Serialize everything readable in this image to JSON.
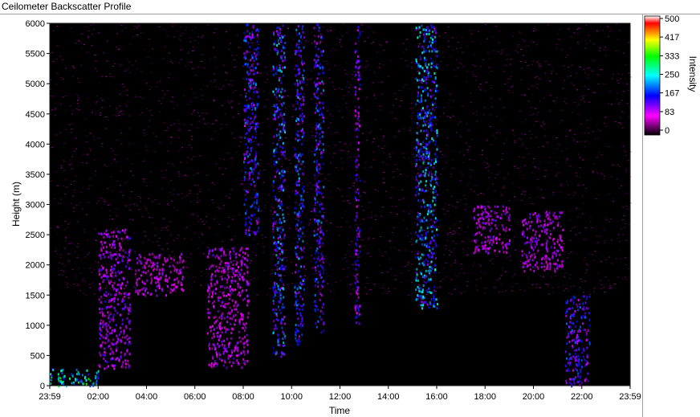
{
  "window": {
    "title": "Ceilometer Backscatter Profile"
  },
  "chart_data": {
    "type": "heatmap",
    "title": "Ceilometer Backscatter Profile",
    "xlabel": "Time",
    "ylabel": "Height (m)",
    "x_tick_labels": [
      "23:59",
      "02:00",
      "04:00",
      "06:00",
      "08:00",
      "10:00",
      "12:00",
      "14:00",
      "16:00",
      "18:00",
      "20:00",
      "22:00",
      "23:59"
    ],
    "xlim_hours": [
      0,
      24
    ],
    "y_ticks": [
      0,
      500,
      1000,
      1500,
      2000,
      2500,
      3000,
      3500,
      4000,
      4500,
      5000,
      5500,
      6000
    ],
    "ylim": [
      0,
      6000
    ],
    "grid": false,
    "colorbar": {
      "label": "Intensity",
      "ticks": [
        500,
        417,
        333,
        250,
        167,
        83,
        0
      ],
      "range": [
        0,
        500
      ],
      "colors": [
        "#000000",
        "#ff00ff",
        "#0000ff",
        "#00ffff",
        "#00ff00",
        "#ffff00",
        "#ff0000",
        "#ffffff"
      ]
    },
    "background_color": "#000000",
    "features": [
      {
        "name": "surface layer",
        "hours": [
          0.0,
          2.0
        ],
        "height": [
          0,
          300
        ],
        "intensity": 250
      },
      {
        "name": "rising layer",
        "hours": [
          2.0,
          3.3
        ],
        "height": [
          300,
          2600
        ],
        "intensity": 110
      },
      {
        "name": "residual layer",
        "hours": [
          3.5,
          5.5
        ],
        "height": [
          1500,
          2200
        ],
        "intensity": 90
      },
      {
        "name": "afternoon layer",
        "hours": [
          6.5,
          8.2
        ],
        "height": [
          300,
          2300
        ],
        "intensity": 100
      },
      {
        "name": "precipitation column",
        "hours": [
          8.0,
          8.6
        ],
        "height": [
          2500,
          6000
        ],
        "intensity": 160
      },
      {
        "name": "precipitation column",
        "hours": [
          9.2,
          9.7
        ],
        "height": [
          500,
          6000
        ],
        "intensity": 180
      },
      {
        "name": "precipitation column",
        "hours": [
          10.1,
          10.5
        ],
        "height": [
          700,
          6000
        ],
        "intensity": 170
      },
      {
        "name": "precipitation column",
        "hours": [
          10.9,
          11.3
        ],
        "height": [
          900,
          6000
        ],
        "intensity": 160
      },
      {
        "name": "precipitation column",
        "hours": [
          12.6,
          12.8
        ],
        "height": [
          1000,
          6000
        ],
        "intensity": 130
      },
      {
        "name": "precipitation column",
        "hours": [
          15.1,
          16.0
        ],
        "height": [
          1300,
          6000
        ],
        "intensity": 200
      },
      {
        "name": "evening layer",
        "hours": [
          17.5,
          19.0
        ],
        "height": [
          2200,
          3000
        ],
        "intensity": 100
      },
      {
        "name": "evening layer",
        "hours": [
          19.5,
          21.2
        ],
        "height": [
          1900,
          2900
        ],
        "intensity": 100
      },
      {
        "name": "night layer",
        "hours": [
          21.3,
          22.3
        ],
        "height": [
          0,
          1500
        ],
        "intensity": 150
      }
    ]
  }
}
